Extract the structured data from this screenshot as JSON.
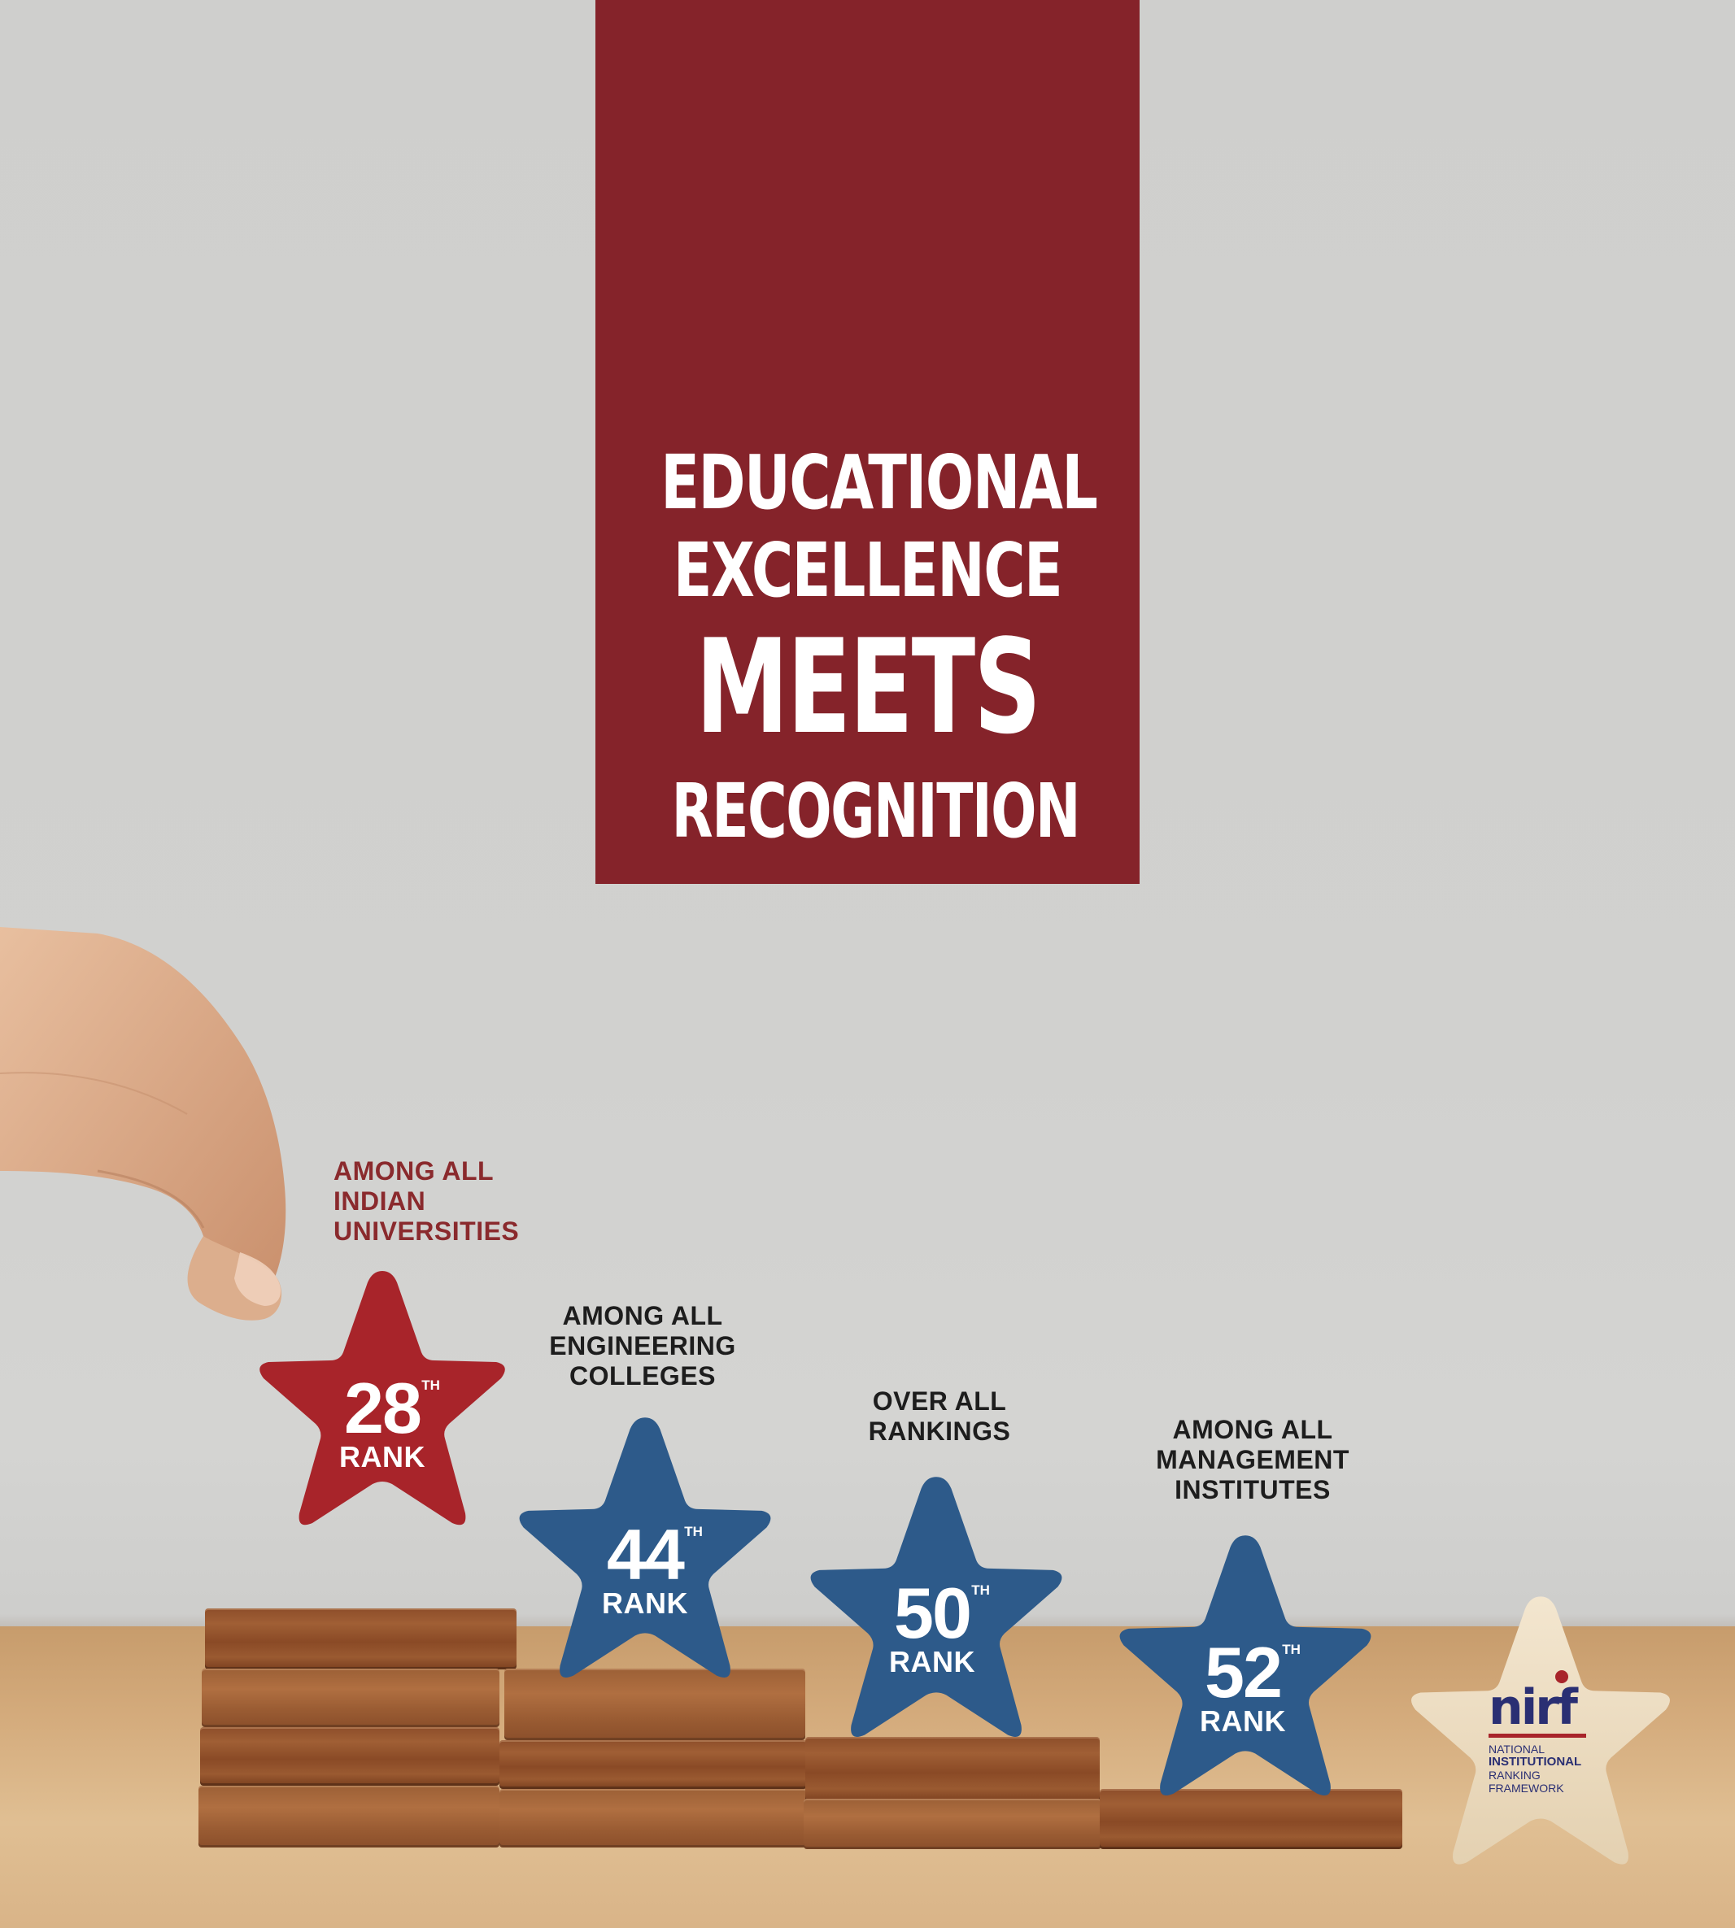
{
  "headline": {
    "line1": "EDUCATIONAL",
    "line2": "EXCELLENCE",
    "line3": "MEETS",
    "line4": "RECOGNITION"
  },
  "rankings": [
    {
      "caption": [
        "AMONG ALL",
        "INDIAN",
        "UNIVERSITIES"
      ],
      "number": "28",
      "suffix": "TH",
      "label": "RANK",
      "color": "#a8242a"
    },
    {
      "caption": [
        "AMONG ALL",
        "ENGINEERING",
        "COLLEGES"
      ],
      "number": "44",
      "suffix": "TH",
      "label": "RANK",
      "color": "#2d5a8a"
    },
    {
      "caption": [
        "OVER ALL",
        "RANKINGS"
      ],
      "number": "50",
      "suffix": "TH",
      "label": "RANK",
      "color": "#2d5a8a"
    },
    {
      "caption": [
        "AMONG ALL",
        "MANAGEMENT",
        "INSTITUTES"
      ],
      "number": "52",
      "suffix": "TH",
      "label": "RANK",
      "color": "#2d5a8a"
    }
  ],
  "nirf": {
    "logo_text": "nirf",
    "line1": "NATIONAL",
    "line2": "INSTITUTIONAL",
    "line3": "RANKING",
    "line4": "FRAMEWORK",
    "color": "#2a2f73",
    "accent": "#a8242a"
  }
}
